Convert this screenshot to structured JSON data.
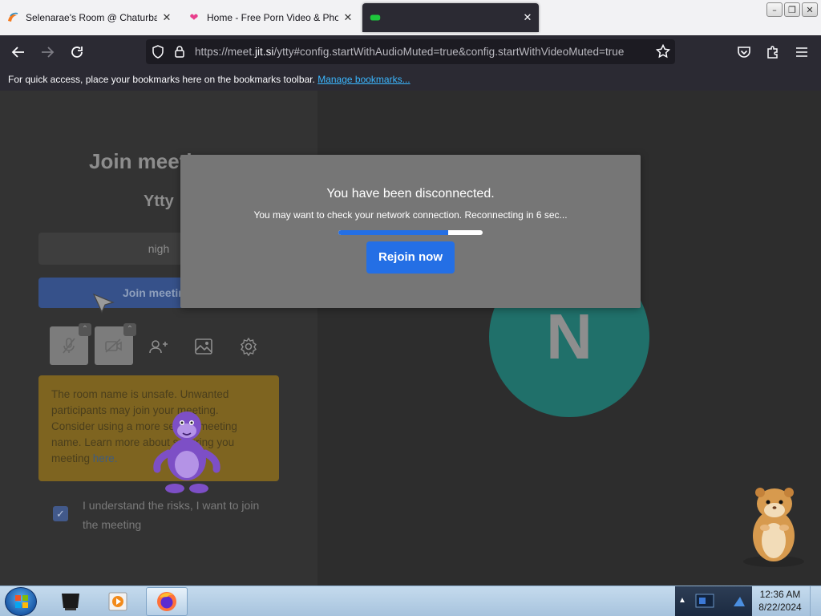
{
  "browser": {
    "tabs": [
      {
        "title": "Selenarae's Room @ Chaturbate",
        "icon": "chaturbate-favicon"
      },
      {
        "title": "Home - Free Porn Video & Photos",
        "icon": "heart-favicon"
      },
      {
        "title": "",
        "icon": "jitsi-favicon",
        "active": true
      }
    ],
    "url_prefix": "https://meet.",
    "url_domain": "jit.si",
    "url_rest": "/ytty#config.startWithAudioMuted=true&config.startWithVideoMuted=true",
    "bookmarks_hint": "For quick access, place your bookmarks here on the bookmarks toolbar.",
    "bookmarks_link": "Manage bookmarks..."
  },
  "prejoin": {
    "title": "Join meeting",
    "room_name": "Ytty",
    "name_value": "nigh",
    "join_label": "Join meeting",
    "warning_line1": "The room name is unsafe. Unwanted",
    "warning_line2": "participants may join your meeting.",
    "warning_line3": "Consider using a more secure meeting",
    "warning_line4": "name. Learn more about securing you",
    "warning_line5_pre": "meeting",
    "warning_link": "here.",
    "consent_text": "I understand the risks, I want to join the meeting",
    "consent_checked": true
  },
  "avatar": {
    "initial": "N",
    "color": "#20706a"
  },
  "dialog": {
    "title": "You have been disconnected.",
    "message": "You may want to check your network connection. Reconnecting in 6 sec...",
    "progress": 0.76,
    "button_label": "Rejoin now",
    "accent": "#246fe5"
  },
  "taskbar": {
    "time": "12:36 AM",
    "date": "8/22/2024"
  }
}
